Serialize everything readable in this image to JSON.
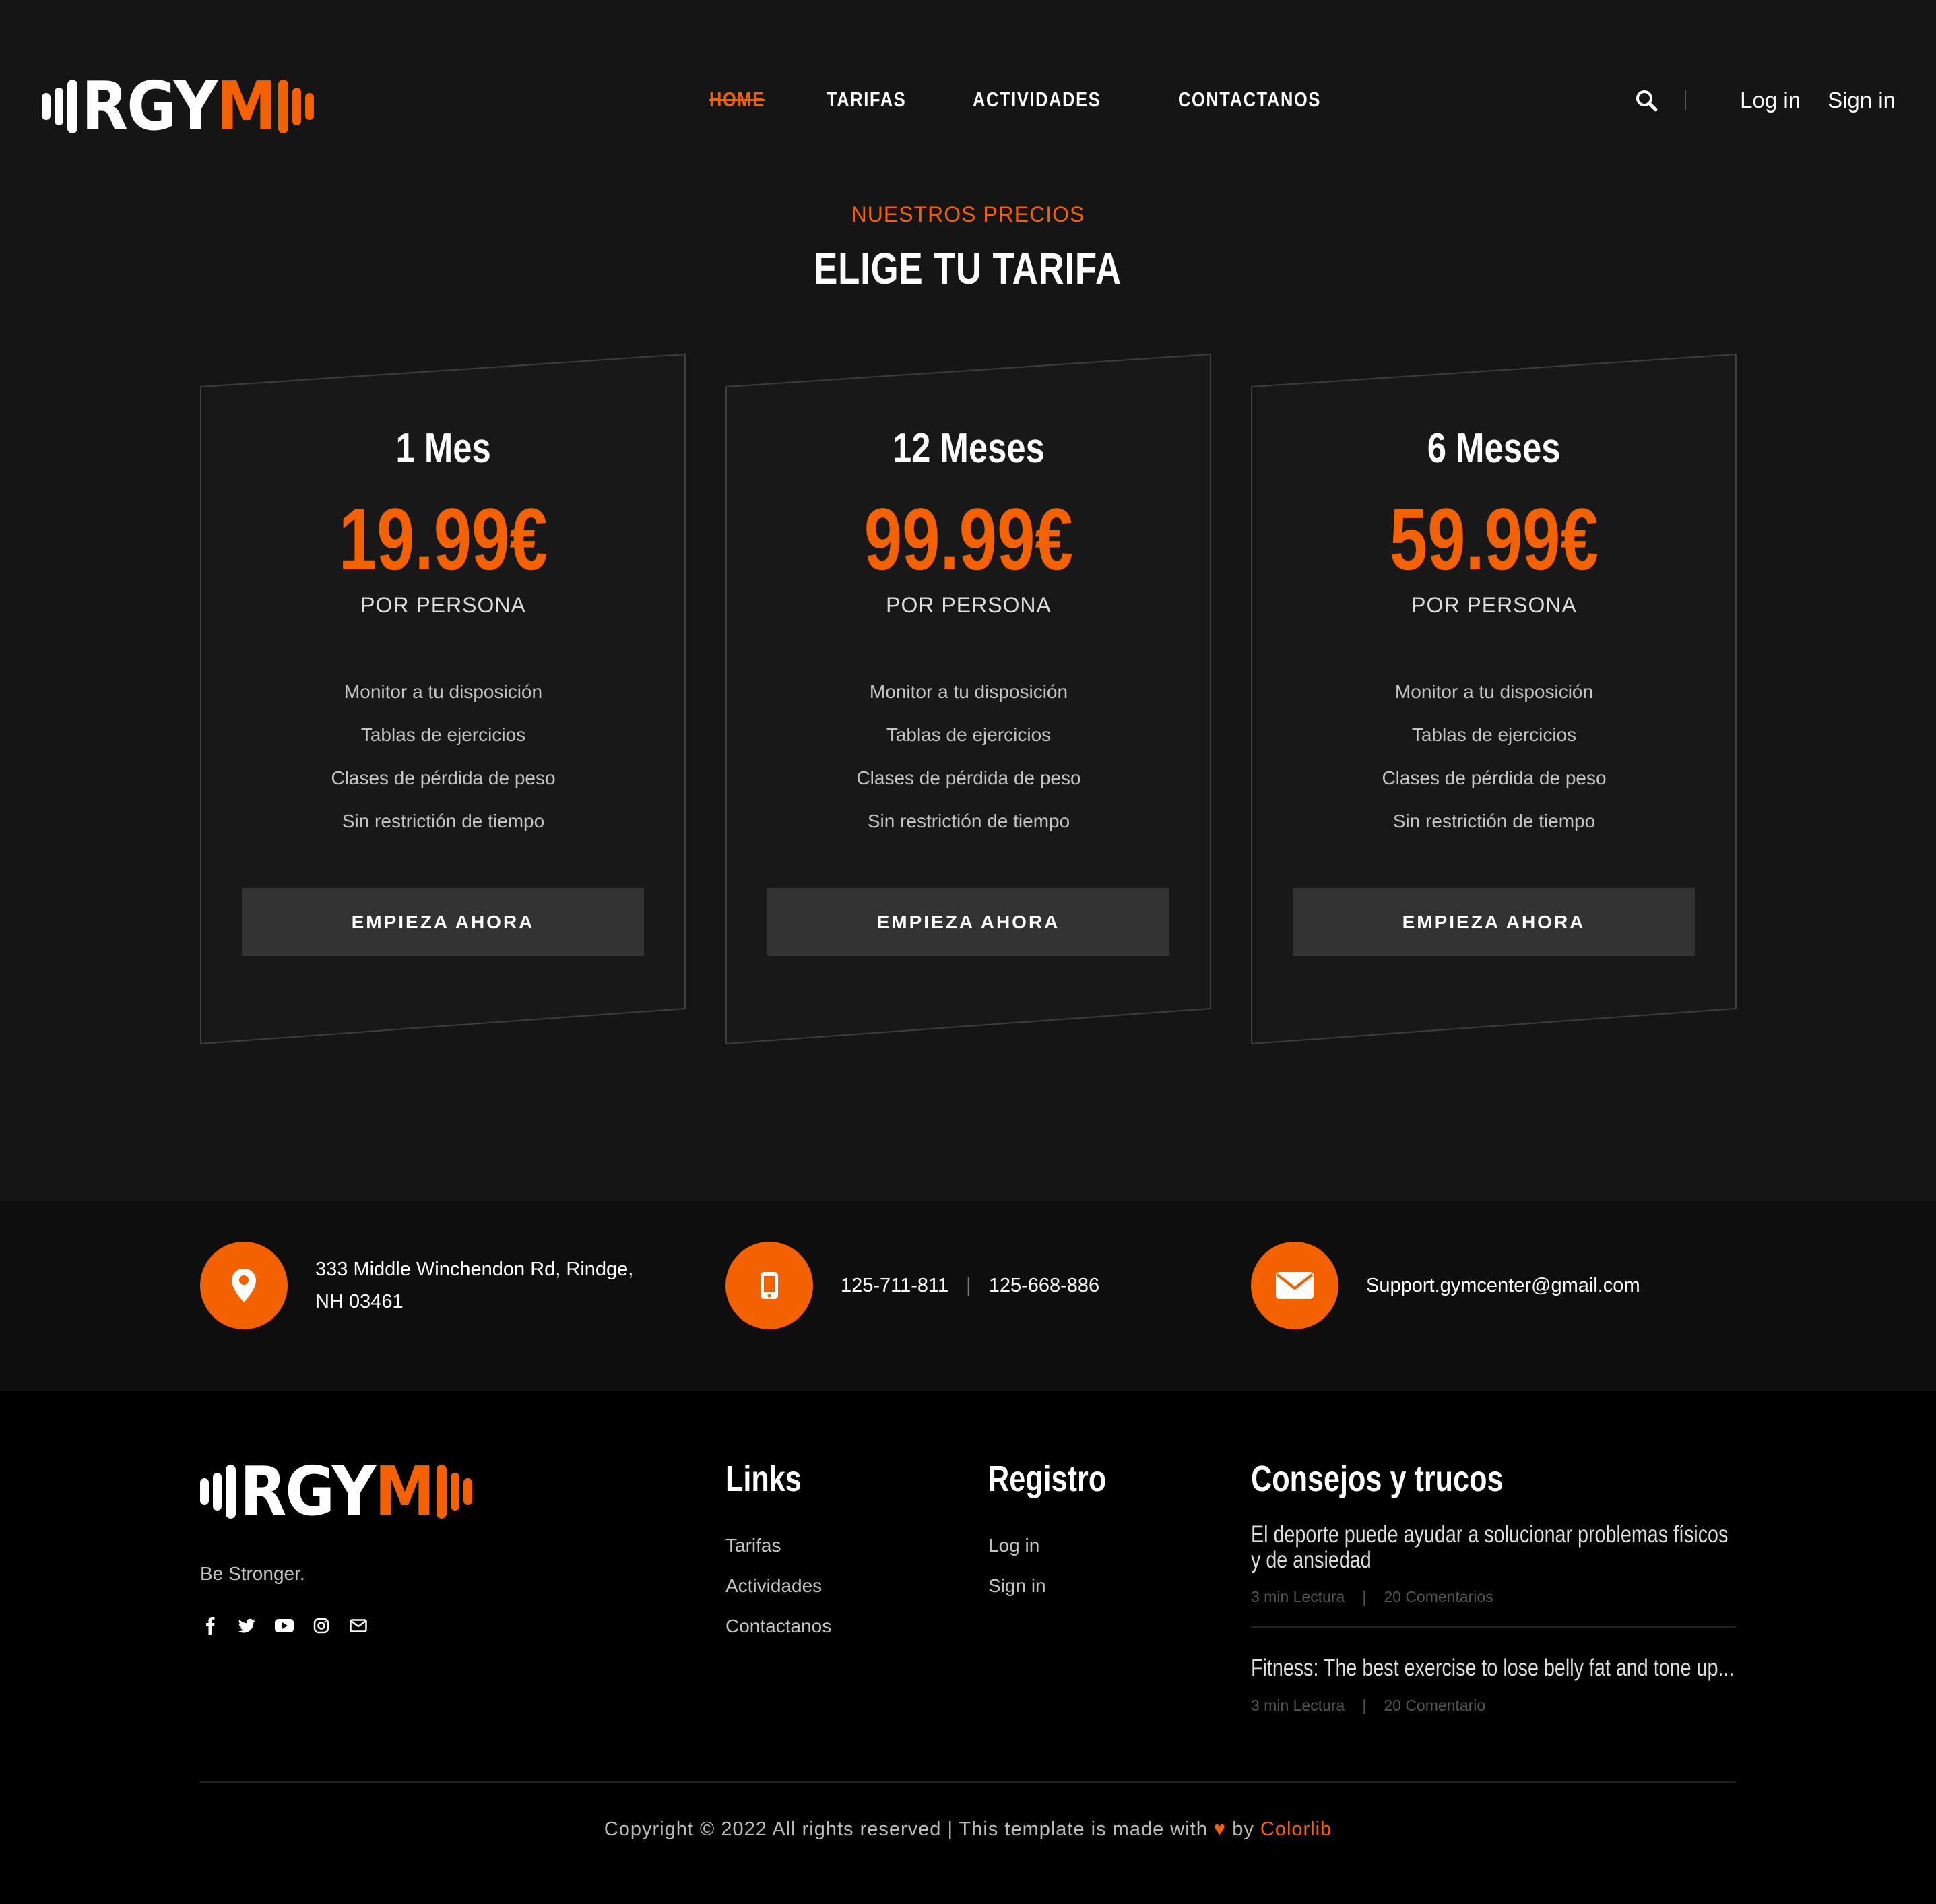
{
  "brand": {
    "logo_white": "RGY",
    "logo_orange": "M"
  },
  "nav": {
    "items": [
      {
        "label": "Home"
      },
      {
        "label": "Tarifas"
      },
      {
        "label": "Actividades"
      },
      {
        "label": "Contactanos"
      }
    ],
    "login": "Log in",
    "signin": "Sign in"
  },
  "pricing": {
    "subtitle": "NUESTROS PRECIOS",
    "title": "ELIGE TU TARIFA",
    "plans": [
      {
        "name": "1 Mes",
        "price": "19.99€",
        "per": "POR PERSONA",
        "features": [
          "Monitor a tu disposición",
          "Tablas de ejercicios",
          "Clases de pérdida de peso",
          "Sin restrictión de tiempo"
        ],
        "button": "EMPIEZA AHORA"
      },
      {
        "name": "12 Meses",
        "price": "99.99€",
        "per": "POR PERSONA",
        "features": [
          "Monitor a tu disposición",
          "Tablas de ejercicios",
          "Clases de pérdida de peso",
          "Sin restrictión de tiempo"
        ],
        "button": "EMPIEZA AHORA"
      },
      {
        "name": "6 Meses",
        "price": "59.99€",
        "per": "POR PERSONA",
        "features": [
          "Monitor a tu disposición",
          "Tablas de ejercicios",
          "Clases de pérdida de peso",
          "Sin restrictión de tiempo"
        ],
        "button": "EMPIEZA AHORA"
      }
    ]
  },
  "contact": {
    "address_line1": "333 Middle Winchendon Rd, Rindge,",
    "address_line2": "NH 03461",
    "phone1": "125-711-811",
    "phone_sep": "|",
    "phone2": "125-668-886",
    "email": "Support.gymcenter@gmail.com"
  },
  "footer": {
    "tagline": "Be Stronger.",
    "links_title": "Links",
    "links": [
      "Tarifas",
      "Actividades",
      "Contactanos"
    ],
    "registro_title": "Registro",
    "registro": [
      "Log in",
      "Sign in"
    ],
    "tips_title": "Consejos y trucos",
    "tips": [
      {
        "title": "El deporte puede ayudar a solucionar problemas físicos y de ansiedad",
        "read": "3 min Lectura",
        "comments": "20 Comentarios"
      },
      {
        "title": "Fitness: The best exercise to lose belly fat and tone up...",
        "read": "3 min Lectura",
        "comments": "20 Comentario"
      }
    ],
    "copyright_pre": "Copyright © 2022 All rights reserved | This template is made with",
    "heart": "♥",
    "copyright_by": "by",
    "copyright_brand": "Colorlib"
  },
  "colors": {
    "accent": "#f36100",
    "background": "#151515",
    "card_button": "#333333"
  },
  "icons": [
    "search-icon",
    "map-pin-icon",
    "mobile-phone-icon",
    "envelope-icon",
    "facebook-icon",
    "twitter-icon",
    "youtube-icon",
    "instagram-icon",
    "mail-icon",
    "heart-icon"
  ]
}
